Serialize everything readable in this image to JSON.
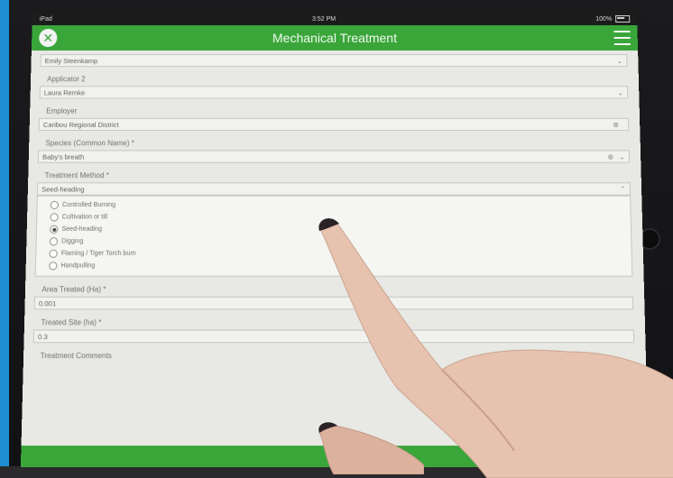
{
  "status_bar": {
    "carrier": "iPad",
    "time": "3:52 PM",
    "battery": "100%"
  },
  "nav": {
    "title": "Mechanical Treatment",
    "close_icon": "close-icon",
    "menu_icon": "hamburger-menu-icon"
  },
  "form": {
    "applicator1": {
      "value": "Emily Steenkamp"
    },
    "applicator2": {
      "label": "Applicator 2",
      "value": "Laura Remke"
    },
    "employer": {
      "label": "Employer",
      "value": "Caribou Regional District"
    },
    "species": {
      "label": "Species (Common Name) *",
      "value": "Baby's breath"
    },
    "method": {
      "label": "Treatment Method *",
      "value": "Seed-heading",
      "options": [
        {
          "label": "Controlled Burning",
          "selected": false
        },
        {
          "label": "Cultivation or till",
          "selected": false
        },
        {
          "label": "Seed-heading",
          "selected": true
        },
        {
          "label": "Digging",
          "selected": false
        },
        {
          "label": "Flaming / Tiger Torch burn",
          "selected": false
        },
        {
          "label": "Handpulling",
          "selected": false
        }
      ]
    },
    "area_treated": {
      "label": "Area Treated (Ha) *",
      "value": "0.001"
    },
    "treated_area": {
      "label": "Treated Site (ha) *",
      "value": "0.3"
    },
    "treatment_comments": {
      "label": "Treatment Comments"
    }
  },
  "colors": {
    "accent": "#3aa63a",
    "screen_bg": "#e8e8e4"
  }
}
